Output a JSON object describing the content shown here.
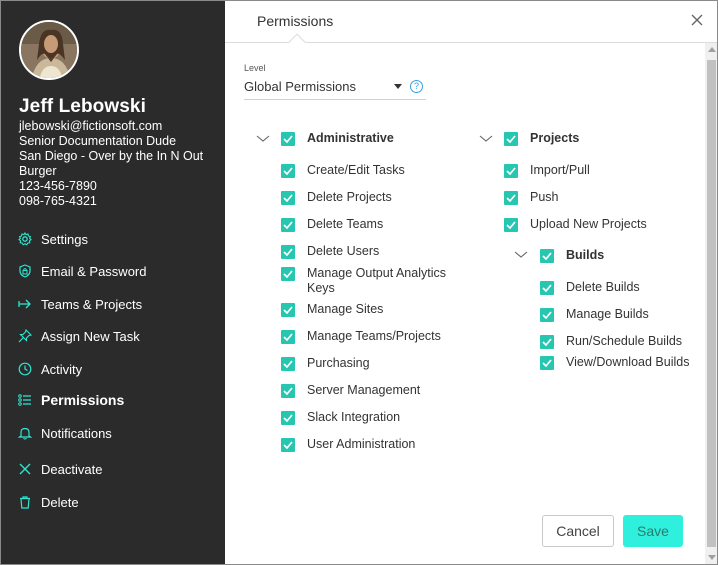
{
  "user": {
    "name": "Jeff Lebowski",
    "email": "jlebowski@fictionsoft.com",
    "title": "Senior Documentation Dude",
    "location": "San Diego - Over by the In N Out Burger",
    "phone1": "123-456-7890",
    "phone2": "098-765-4321"
  },
  "nav": {
    "settings": "Settings",
    "email_password": "Email & Password",
    "teams_projects": "Teams & Projects",
    "assign_task": "Assign New Task",
    "activity": "Activity",
    "permissions": "Permissions",
    "notifications": "Notifications",
    "deactivate": "Deactivate",
    "delete": "Delete"
  },
  "dialog": {
    "title": "Permissions",
    "level_label": "Level",
    "level_value": "Global Permissions",
    "help": "?"
  },
  "admin": {
    "label": "Administrative",
    "items": [
      "Create/Edit Tasks",
      "Delete Projects",
      "Delete Teams",
      "Delete Users",
      "Manage Output Analytics Keys",
      "Manage Sites",
      "Manage Teams/Projects",
      "Purchasing",
      "Server Management",
      "Slack Integration",
      "User Administration"
    ]
  },
  "projects": {
    "label": "Projects",
    "items": [
      "Import/Pull",
      "Push",
      "Upload New Projects"
    ]
  },
  "builds": {
    "label": "Builds",
    "items": [
      "Delete Builds",
      "Manage Builds",
      "Run/Schedule Builds",
      "View/Download Builds"
    ]
  },
  "buttons": {
    "cancel": "Cancel",
    "save": "Save"
  },
  "colors": {
    "sidebar": "#2b2b2b",
    "accent": "#26c6b0",
    "save": "#2ff0dc"
  }
}
